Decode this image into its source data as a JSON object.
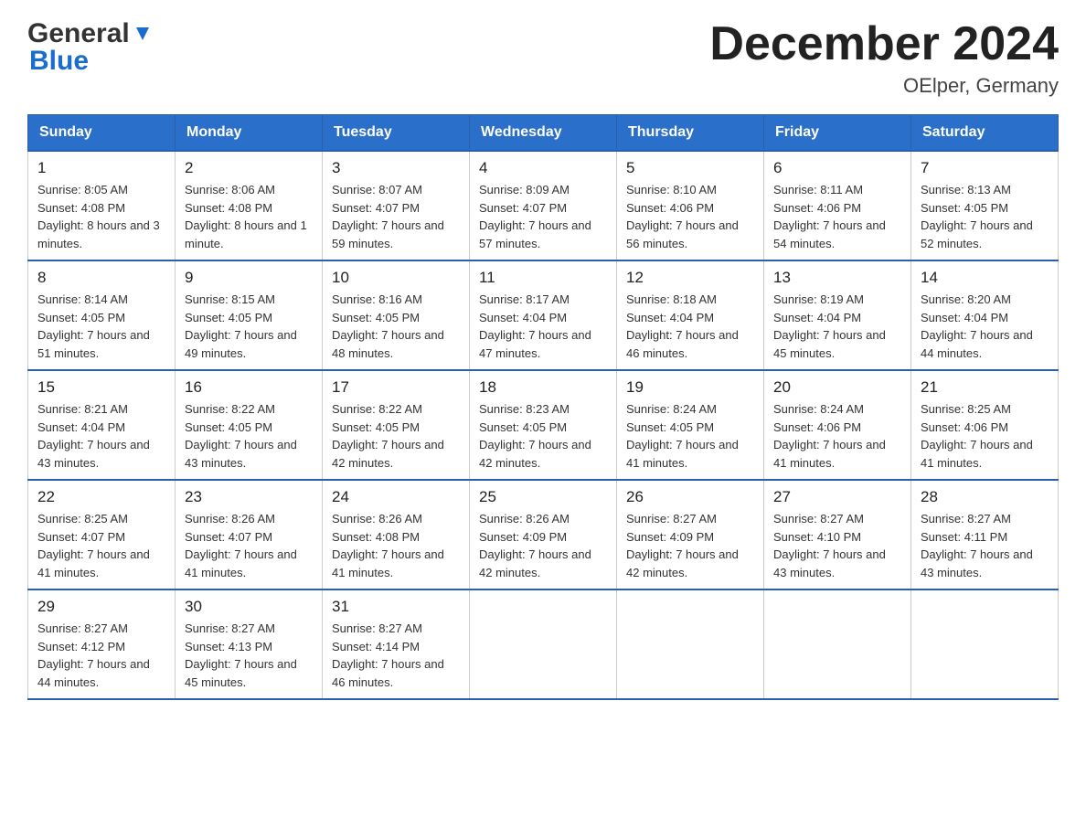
{
  "header": {
    "logo_general": "General",
    "logo_blue": "Blue",
    "month_title": "December 2024",
    "location": "OElper, Germany"
  },
  "days_of_week": [
    "Sunday",
    "Monday",
    "Tuesday",
    "Wednesday",
    "Thursday",
    "Friday",
    "Saturday"
  ],
  "weeks": [
    [
      {
        "day": "1",
        "sunrise": "8:05 AM",
        "sunset": "4:08 PM",
        "daylight": "8 hours and 3 minutes."
      },
      {
        "day": "2",
        "sunrise": "8:06 AM",
        "sunset": "4:08 PM",
        "daylight": "8 hours and 1 minute."
      },
      {
        "day": "3",
        "sunrise": "8:07 AM",
        "sunset": "4:07 PM",
        "daylight": "7 hours and 59 minutes."
      },
      {
        "day": "4",
        "sunrise": "8:09 AM",
        "sunset": "4:07 PM",
        "daylight": "7 hours and 57 minutes."
      },
      {
        "day": "5",
        "sunrise": "8:10 AM",
        "sunset": "4:06 PM",
        "daylight": "7 hours and 56 minutes."
      },
      {
        "day": "6",
        "sunrise": "8:11 AM",
        "sunset": "4:06 PM",
        "daylight": "7 hours and 54 minutes."
      },
      {
        "day": "7",
        "sunrise": "8:13 AM",
        "sunset": "4:05 PM",
        "daylight": "7 hours and 52 minutes."
      }
    ],
    [
      {
        "day": "8",
        "sunrise": "8:14 AM",
        "sunset": "4:05 PM",
        "daylight": "7 hours and 51 minutes."
      },
      {
        "day": "9",
        "sunrise": "8:15 AM",
        "sunset": "4:05 PM",
        "daylight": "7 hours and 49 minutes."
      },
      {
        "day": "10",
        "sunrise": "8:16 AM",
        "sunset": "4:05 PM",
        "daylight": "7 hours and 48 minutes."
      },
      {
        "day": "11",
        "sunrise": "8:17 AM",
        "sunset": "4:04 PM",
        "daylight": "7 hours and 47 minutes."
      },
      {
        "day": "12",
        "sunrise": "8:18 AM",
        "sunset": "4:04 PM",
        "daylight": "7 hours and 46 minutes."
      },
      {
        "day": "13",
        "sunrise": "8:19 AM",
        "sunset": "4:04 PM",
        "daylight": "7 hours and 45 minutes."
      },
      {
        "day": "14",
        "sunrise": "8:20 AM",
        "sunset": "4:04 PM",
        "daylight": "7 hours and 44 minutes."
      }
    ],
    [
      {
        "day": "15",
        "sunrise": "8:21 AM",
        "sunset": "4:04 PM",
        "daylight": "7 hours and 43 minutes."
      },
      {
        "day": "16",
        "sunrise": "8:22 AM",
        "sunset": "4:05 PM",
        "daylight": "7 hours and 43 minutes."
      },
      {
        "day": "17",
        "sunrise": "8:22 AM",
        "sunset": "4:05 PM",
        "daylight": "7 hours and 42 minutes."
      },
      {
        "day": "18",
        "sunrise": "8:23 AM",
        "sunset": "4:05 PM",
        "daylight": "7 hours and 42 minutes."
      },
      {
        "day": "19",
        "sunrise": "8:24 AM",
        "sunset": "4:05 PM",
        "daylight": "7 hours and 41 minutes."
      },
      {
        "day": "20",
        "sunrise": "8:24 AM",
        "sunset": "4:06 PM",
        "daylight": "7 hours and 41 minutes."
      },
      {
        "day": "21",
        "sunrise": "8:25 AM",
        "sunset": "4:06 PM",
        "daylight": "7 hours and 41 minutes."
      }
    ],
    [
      {
        "day": "22",
        "sunrise": "8:25 AM",
        "sunset": "4:07 PM",
        "daylight": "7 hours and 41 minutes."
      },
      {
        "day": "23",
        "sunrise": "8:26 AM",
        "sunset": "4:07 PM",
        "daylight": "7 hours and 41 minutes."
      },
      {
        "day": "24",
        "sunrise": "8:26 AM",
        "sunset": "4:08 PM",
        "daylight": "7 hours and 41 minutes."
      },
      {
        "day": "25",
        "sunrise": "8:26 AM",
        "sunset": "4:09 PM",
        "daylight": "7 hours and 42 minutes."
      },
      {
        "day": "26",
        "sunrise": "8:27 AM",
        "sunset": "4:09 PM",
        "daylight": "7 hours and 42 minutes."
      },
      {
        "day": "27",
        "sunrise": "8:27 AM",
        "sunset": "4:10 PM",
        "daylight": "7 hours and 43 minutes."
      },
      {
        "day": "28",
        "sunrise": "8:27 AM",
        "sunset": "4:11 PM",
        "daylight": "7 hours and 43 minutes."
      }
    ],
    [
      {
        "day": "29",
        "sunrise": "8:27 AM",
        "sunset": "4:12 PM",
        "daylight": "7 hours and 44 minutes."
      },
      {
        "day": "30",
        "sunrise": "8:27 AM",
        "sunset": "4:13 PM",
        "daylight": "7 hours and 45 minutes."
      },
      {
        "day": "31",
        "sunrise": "8:27 AM",
        "sunset": "4:14 PM",
        "daylight": "7 hours and 46 minutes."
      },
      null,
      null,
      null,
      null
    ]
  ],
  "labels": {
    "sunrise": "Sunrise:",
    "sunset": "Sunset:",
    "daylight": "Daylight:"
  }
}
